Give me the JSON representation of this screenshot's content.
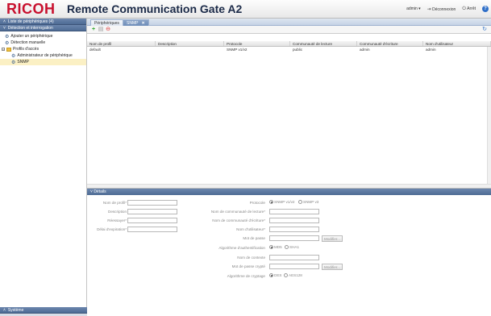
{
  "header": {
    "logo": "RICOH",
    "app_title": "Remote Communication Gate A2",
    "user": "admin",
    "user_caret": "▾",
    "logout": "Déconnexion",
    "shutdown": "Arrêt",
    "help": "?"
  },
  "sidebar": {
    "devices_header": "Liste de périphériques (4)",
    "discovery_header": "Détection et interrogation",
    "items": [
      {
        "label": "Ajouter un périphérique"
      },
      {
        "label": "Détection manuelle"
      },
      {
        "label": "Profils d'accès"
      },
      {
        "label": "Administrateur de périphérique"
      },
      {
        "label": "SNMP"
      }
    ],
    "system_header": "Système"
  },
  "tabs": [
    {
      "label": "Périphériques"
    },
    {
      "label": "SNMP",
      "close": "✕"
    }
  ],
  "grid": {
    "columns": [
      "Nom de profil",
      "Description",
      "Protocole",
      "Communauté de lecture",
      "Communauté d'écriture",
      "Nom d'utilisateur"
    ],
    "rows": [
      [
        "default",
        "",
        "SNMP v1/v2",
        "public",
        "admin",
        "admin"
      ]
    ]
  },
  "details": {
    "header": "Détails",
    "left": {
      "profile_name": "Nom de profil*",
      "description": "Description",
      "retries": "Réessayer*",
      "timeout": "Délai d'expiration*"
    },
    "right": {
      "protocol": "Protocole",
      "protocol_options": [
        "SNMP v1/v2",
        "SNMP v3"
      ],
      "read_community": "Nom de communauté de lecture*",
      "write_community": "Nom de communauté d'écriture*",
      "username": "Nom d'utilisateur*",
      "password": "Mot de passe",
      "modify": "Modifier...",
      "auth_algorithm": "Algorithme d'authentification",
      "auth_options": [
        "MD5",
        "SHA1"
      ],
      "context_name": "Nom de contexte",
      "encrypted_password": "Mot de passe crypté",
      "modify2": "Modifier...",
      "encryption_algorithm": "Algorithme de cryptage",
      "encryption_options": [
        "DES",
        "AES128"
      ]
    }
  }
}
